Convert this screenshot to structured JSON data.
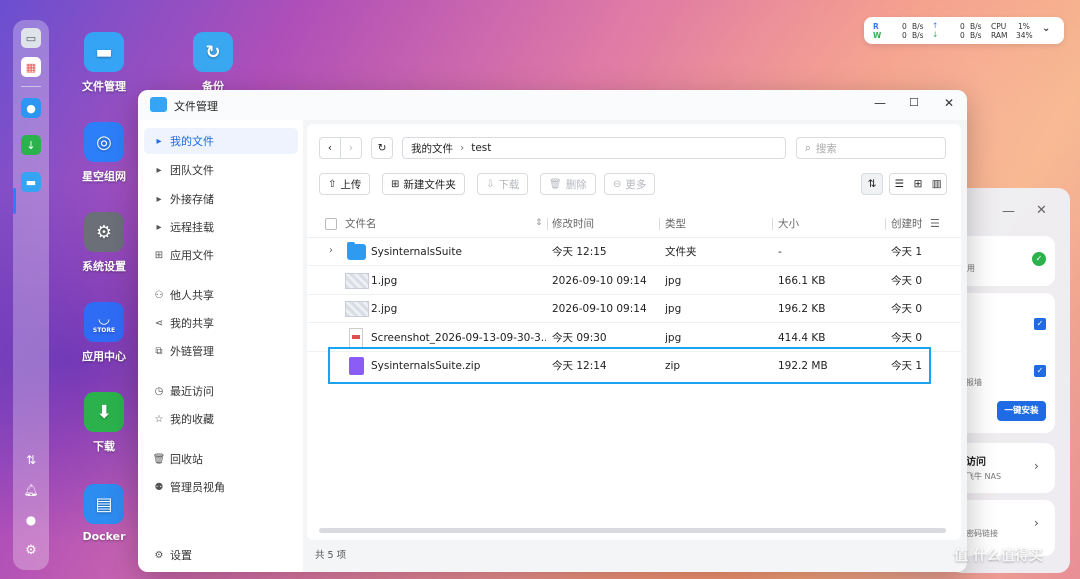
{
  "desktop": {
    "icons": [
      {
        "label": "文件管理",
        "icon": "folder-icon",
        "color": "#35a4f4"
      },
      {
        "label": "备份",
        "icon": "backup-icon",
        "color": "#3aa8f0"
      },
      {
        "label": "星空组网",
        "icon": "globe-icon",
        "color": "#2d7ff9"
      },
      {
        "label": "系统设置",
        "icon": "gear-icon",
        "color": "#6b6f78"
      },
      {
        "label": "应用中心",
        "icon": "store-icon",
        "color": "#2f6cf5",
        "badge": "STORE"
      },
      {
        "label": "下载",
        "icon": "download-icon",
        "color": "#2bb24c"
      },
      {
        "label": "Docker",
        "icon": "docker-icon",
        "color": "#2d8cf0"
      }
    ]
  },
  "netmon": {
    "r_label": "R",
    "w_label": "W",
    "r_in": "0",
    "r_out": "0",
    "w_in": "0",
    "w_out": "0",
    "unit": "B/s",
    "cpu_label": "CPU",
    "cpu_value": "1%",
    "ram_label": "RAM",
    "ram_value": "34%"
  },
  "window": {
    "title": "文件管理",
    "sidebar": [
      {
        "label": "我的文件",
        "icon": "caret-right-icon",
        "active": true
      },
      {
        "label": "团队文件",
        "icon": "caret-right-icon"
      },
      {
        "label": "外接存储",
        "icon": "caret-right-icon"
      },
      {
        "label": "远程挂载",
        "icon": "caret-right-icon"
      },
      {
        "label": "应用文件",
        "icon": "grid-icon"
      },
      {
        "label": "他人共享",
        "icon": "user-share-icon"
      },
      {
        "label": "我的共享",
        "icon": "share-icon"
      },
      {
        "label": "外链管理",
        "icon": "link-icon"
      },
      {
        "label": "最近访问",
        "icon": "clock-icon"
      },
      {
        "label": "我的收藏",
        "icon": "star-icon"
      },
      {
        "label": "回收站",
        "icon": "trash-icon"
      },
      {
        "label": "管理员视角",
        "icon": "admin-icon"
      }
    ],
    "settings_label": "设置",
    "breadcrumb": [
      "我的文件",
      "test"
    ],
    "search_placeholder": "搜索",
    "toolbar": {
      "upload": "上传",
      "new_folder": "新建文件夹",
      "download": "下载",
      "delete": "删除",
      "more": "更多"
    },
    "columns": [
      "文件名",
      "修改时间",
      "类型",
      "大小",
      "创建时"
    ],
    "rows": [
      {
        "name": "SysinternalsSuite",
        "modified": "今天 12:15",
        "type": "文件夹",
        "size": "-",
        "created": "今天 1"
      },
      {
        "name": "1.jpg",
        "modified": "2026-09-10 09:14",
        "type": "jpg",
        "size": "166.1 KB",
        "created": "今天 0"
      },
      {
        "name": "2.jpg",
        "modified": "2026-09-10 09:14",
        "type": "jpg",
        "size": "196.2 KB",
        "created": "今天 0"
      },
      {
        "name": "Screenshot_2026-09-13-09-30-3...",
        "modified": "今天 09:30",
        "type": "jpg",
        "size": "414.4 KB",
        "created": "今天 0"
      },
      {
        "name": "SysinternalsSuite.zip",
        "modified": "今天 12:14",
        "type": "zip",
        "size": "192.2 MB",
        "created": "今天 1"
      }
    ],
    "footer": "共 5 项"
  },
  "right_panel": {
    "item1_sub": "用",
    "item2_sub": "报墙",
    "install_button": "一键安装",
    "item3_title": "访问",
    "item3_sub": "飞牛 NAS",
    "item4_sub": "密码链接"
  },
  "watermark": "值 什么值得买",
  "colors": {
    "accent": "#1e6be3",
    "highlight": "#1aa3f0"
  }
}
